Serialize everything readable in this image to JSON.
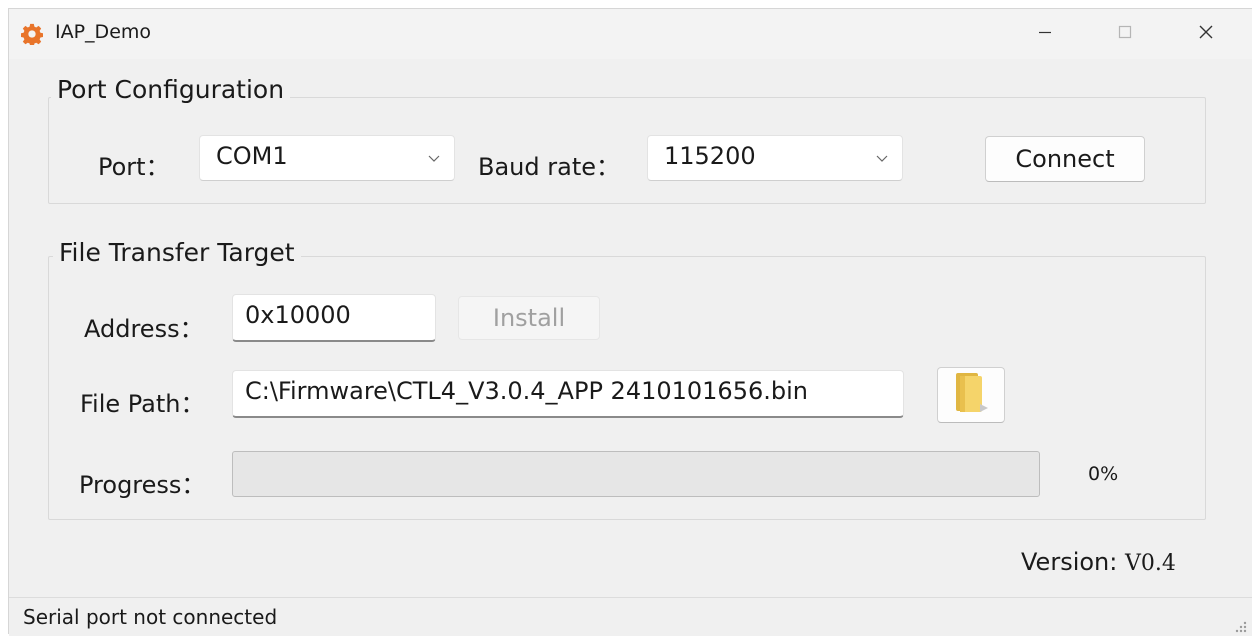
{
  "window": {
    "title": "IAP_Demo",
    "app_icon": "gear-icon",
    "controls": [
      "minimize-icon",
      "maximize-icon",
      "close-icon"
    ]
  },
  "port_config": {
    "group_title": "Port Configuration",
    "port_label": "Port：",
    "port_value": "COM1",
    "baud_label": "Baud rate：",
    "baud_value": "115200",
    "connect_label": "Connect"
  },
  "file_transfer": {
    "group_title": "File Transfer Target",
    "address_label": "Address：",
    "address_value": "0x10000",
    "install_label": "Install",
    "install_enabled": false,
    "file_path_label": "File Path：",
    "file_path_value": "C:\\Firmware\\CTL4_V3.0.4_APP 2410101656.bin",
    "browse_icon": "folder-icon",
    "progress_label": "Progress：",
    "progress_value": 0,
    "progress_text": "0%"
  },
  "version": {
    "label": "Version:",
    "value": "V0.4"
  },
  "status": {
    "text": "Serial port not connected"
  },
  "colors": {
    "accent_icon": "#e8742a",
    "progress_fill": "#06b025"
  }
}
